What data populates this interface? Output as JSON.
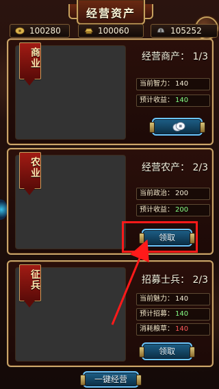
{
  "header": {
    "title": "经营资产"
  },
  "resources": [
    {
      "icon": "coin-icon",
      "value": "100280"
    },
    {
      "icon": "gold-ingot-icon",
      "value": "100060"
    },
    {
      "icon": "helmet-icon",
      "value": "105252"
    }
  ],
  "cards": [
    {
      "banner": "商业",
      "heading": "经营商产： 1/3",
      "stats": [
        {
          "key": "当前智力：",
          "value": "140",
          "value_color": "#f6efd8"
        },
        {
          "key": "预计收益：",
          "value": "140",
          "value_color": "#86ff86"
        }
      ],
      "button": {
        "label": ""
      }
    },
    {
      "banner": "农业",
      "heading": "经营农产： 2/3",
      "stats": [
        {
          "key": "当前政治：",
          "value": "200",
          "value_color": "#f6efd8"
        },
        {
          "key": "预计收益：",
          "value": "200",
          "value_color": "#86ff86"
        }
      ],
      "button": {
        "label": "领取"
      }
    },
    {
      "banner": "征兵",
      "heading": "招募士兵： 2/3",
      "stats": [
        {
          "key": "当前魅力：",
          "value": "140",
          "value_color": "#f6efd8"
        },
        {
          "key": "预计招募：",
          "value": "140",
          "value_color": "#86ff86"
        },
        {
          "key": "消耗粮草：",
          "value": "140",
          "value_color": "#ff5b5b"
        }
      ],
      "button": {
        "label": "领取"
      }
    }
  ],
  "bottom": {
    "label": "一键经营"
  }
}
